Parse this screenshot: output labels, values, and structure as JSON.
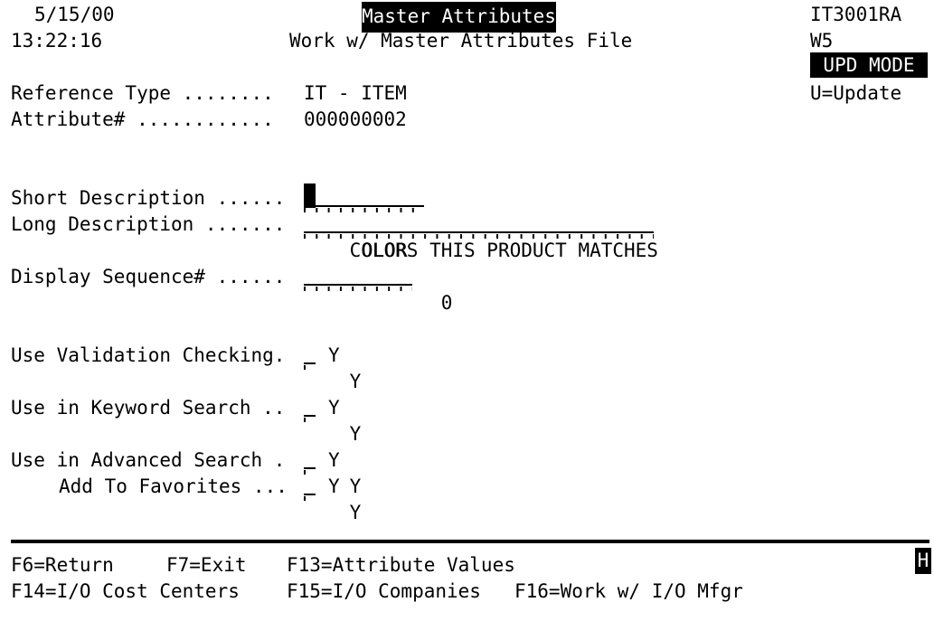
{
  "terminal": {
    "program_id": "IT3001RA",
    "workstation": "W5",
    "mode_badge": "UPD MODE",
    "mode_legend": "U=Update",
    "status_indicator": "H"
  },
  "header": {
    "date": "5/15/00",
    "time": "13:22:16",
    "title": "Master Attributes",
    "subtitle": "Work w/ Master Attributes File"
  },
  "key_fields": [
    {
      "label": "Reference Type ........",
      "value": "IT - ITEM"
    },
    {
      "label": "Attribute# ............",
      "value": "000000002"
    }
  ],
  "form": {
    "short_description": {
      "label": "Short Description ......",
      "value": "COLOR",
      "visible_text": "OLOR",
      "field_width_chars": 10,
      "cursor_position": 0
    },
    "long_description": {
      "label": "Long Description .......",
      "value": "COLORS THIS PRODUCT MATCHES",
      "field_width_chars": 29
    },
    "display_sequence": {
      "label": "Display Sequence# ......",
      "value": "        0",
      "field_width_chars": 9
    },
    "options": [
      {
        "label": "Use Validation Checking.",
        "value": "Y",
        "default_shown": "Y"
      },
      {
        "label": "Use in Keyword Search ..",
        "value": "Y",
        "default_shown": "Y"
      },
      {
        "label": "Use in Advanced Search .",
        "value": "Y",
        "default_shown": "Y"
      },
      {
        "label": "Add To Favorites ...",
        "value": "Y",
        "default_shown": "Y"
      }
    ]
  },
  "function_keys": {
    "line1": [
      {
        "text": "F6=Return"
      },
      {
        "text": "F7=Exit"
      },
      {
        "text": "F13=Attribute Values"
      }
    ],
    "line2": [
      {
        "text": "F14=I/O Cost Centers"
      },
      {
        "text": "F15=I/O Companies"
      },
      {
        "text": "F16=Work w/ I/O Mfgr"
      }
    ]
  }
}
